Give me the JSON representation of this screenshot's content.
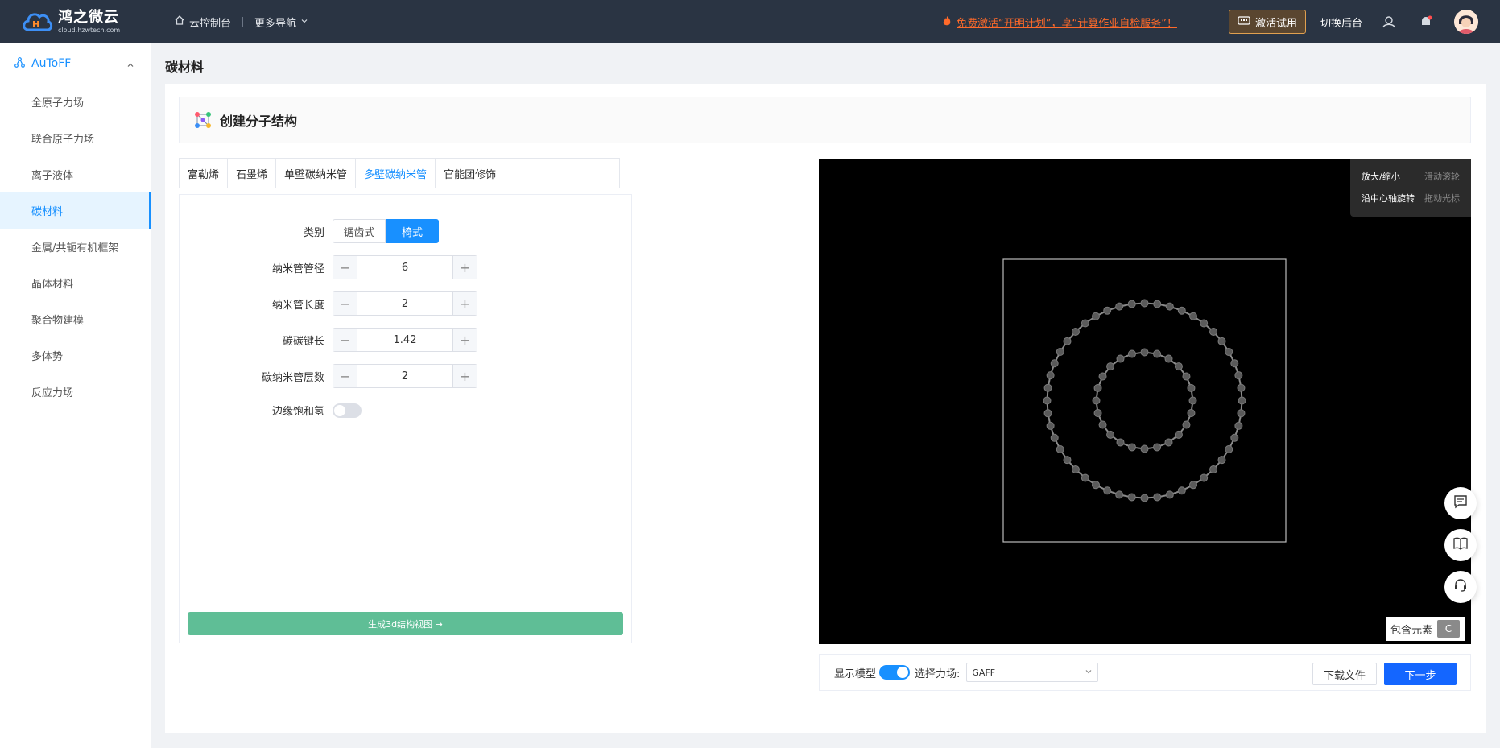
{
  "brand": {
    "name": "鸿之微云",
    "domain": "cloud.hzwtech.com"
  },
  "topnav": {
    "console": "云控制台",
    "more_nav": "更多导航",
    "promo": "免费激活“开明计划”，享“计算作业自检服务”！",
    "trial_button": "激活试用",
    "switch_backend": "切换后台"
  },
  "sidebar": {
    "group": "AuToFF",
    "items": [
      {
        "label": "全原子力场"
      },
      {
        "label": "联合原子力场"
      },
      {
        "label": "离子液体"
      },
      {
        "label": "碳材料"
      },
      {
        "label": "金属/共轭有机框架"
      },
      {
        "label": "晶体材料"
      },
      {
        "label": "聚合物建模"
      },
      {
        "label": "多体势"
      },
      {
        "label": "反应力场"
      }
    ]
  },
  "page": {
    "title": "碳材料",
    "card_title": "创建分子结构"
  },
  "tabs": [
    {
      "label": "富勒烯"
    },
    {
      "label": "石墨烯"
    },
    {
      "label": "单壁碳纳米管"
    },
    {
      "label": "多壁碳纳米管"
    },
    {
      "label": "官能团修饰"
    }
  ],
  "form": {
    "category_label": "类别",
    "category_options": [
      "锯齿式",
      "椅式"
    ],
    "diameter_label": "纳米管管径",
    "diameter_value": "6",
    "length_label": "纳米管长度",
    "length_value": "2",
    "bond_label": "碳碳键长",
    "bond_value": "1.42",
    "layers_label": "碳纳米管层数",
    "layers_value": "2",
    "saturate_label": "边缘饱和氢",
    "generate_button": "生成3d结构视图 →"
  },
  "viewer": {
    "hint_zoom": "放大/缩小",
    "hint_zoom_desc": "滑动滚轮",
    "hint_rotate": "沿中心轴旋转",
    "hint_rotate_desc": "拖动光标",
    "elements_label": "包含元素",
    "element_chip": "C"
  },
  "bottom": {
    "show_model": "显示模型",
    "force_field_label": "选择力场:",
    "force_field_value": "GAFF",
    "download": "下载文件",
    "next": "下一步"
  },
  "colors": {
    "accent": "#1890ff",
    "topbar": "#2a3443",
    "promo": "#ff6a2a",
    "generate": "#5fbe96",
    "next_button": "#1466ff"
  }
}
